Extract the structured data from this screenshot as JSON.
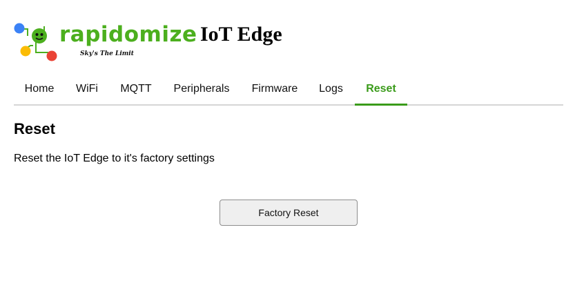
{
  "brand": {
    "name": "rapidomize",
    "tagline": "Sky's The Limit",
    "colors": {
      "green": "#4caf1e",
      "blue": "#3b82f6",
      "yellow": "#fbbc05",
      "red": "#ea4335"
    }
  },
  "header": {
    "title": "IoT Edge"
  },
  "nav": {
    "tabs": [
      {
        "label": "Home"
      },
      {
        "label": "WiFi"
      },
      {
        "label": "MQTT"
      },
      {
        "label": "Peripherals"
      },
      {
        "label": "Firmware"
      },
      {
        "label": "Logs"
      },
      {
        "label": "Reset",
        "active": true
      }
    ],
    "accent": "#3a9b1a"
  },
  "main": {
    "title": "Reset",
    "description": "Reset the IoT Edge to it's factory settings",
    "reset_button_label": "Factory Reset"
  }
}
